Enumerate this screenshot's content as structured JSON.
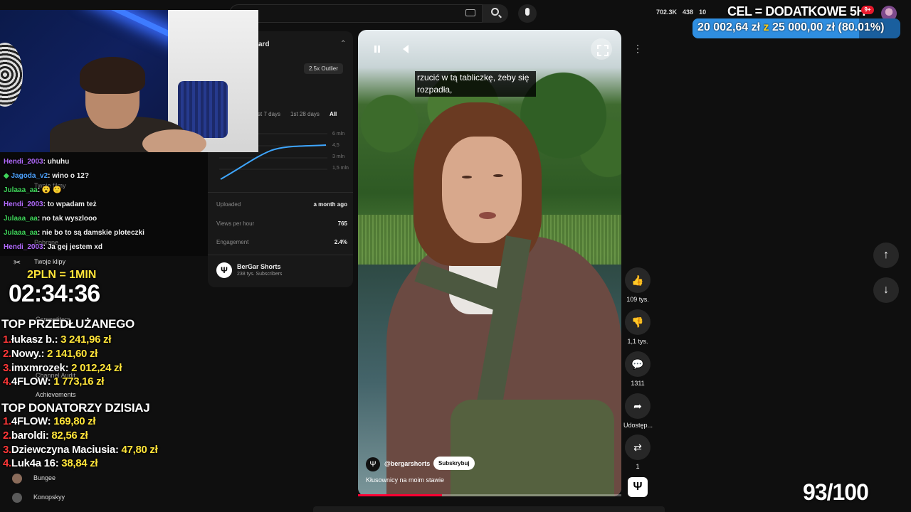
{
  "topbar": {
    "stats": [
      "702.3K",
      "438",
      "10"
    ],
    "notif_count": "9+"
  },
  "goal": {
    "title": "CEL = DODATKOWE 5H",
    "current": "20 002,64 zł",
    "joiner": "z",
    "target": "25 000,00 zł",
    "percent_label": "(80.01%)",
    "progress_fraction": 0.8001,
    "bar_color": "#1a5f9e",
    "fill_color": "#2f8ee0"
  },
  "panel": {
    "title": "ard",
    "outlier": "2.5x Outlier",
    "ranges": [
      "st 7 days",
      "1st 28 days",
      "All"
    ],
    "yticks": [
      "6 mln",
      "4,5",
      "3 mln",
      "1,5 mln"
    ],
    "rows": [
      {
        "label": "Uploaded",
        "value": "a month ago"
      },
      {
        "label": "Views per hour",
        "value": "765"
      },
      {
        "label": "Engagement",
        "value": "2.4%"
      }
    ],
    "channel_name": "BerGar Shorts",
    "channel_subs": "238 tys. Subscribers"
  },
  "sidebar_ghost": [
    {
      "label": "Twoje filmy"
    },
    {
      "label": "Pobrane"
    },
    {
      "label": "Twoje klipy"
    },
    {
      "label": "Competitors"
    },
    {
      "label": "Channel Audit"
    },
    {
      "label": "Achievements"
    }
  ],
  "chat": [
    {
      "user": "Hendi_2003",
      "msg": ": uhuhu",
      "color": "#b36bff"
    },
    {
      "user": "Jagoda_v2",
      "msg": ": wino o 12?",
      "color": "#4da3ff"
    },
    {
      "user": "Julaaa_aa",
      "msg": ": 😮 🙂",
      "color": "#3fd45a"
    },
    {
      "user": "Hendi_2003",
      "msg": ": to wpadam też",
      "color": "#b36bff"
    },
    {
      "user": "Julaaa_aa",
      "msg": ": no tak wyszlooo",
      "color": "#3fd45a"
    },
    {
      "user": "Julaaa_aa",
      "msg": ": nie bo to są damskie ploteczki",
      "color": "#3fd45a"
    },
    {
      "user": "Hendi_2003",
      "msg": ": Ja gej jestem xd",
      "color": "#b36bff"
    }
  ],
  "timer": {
    "rate": "2PLN = 1MIN",
    "value": "02:34:36"
  },
  "top_extend": {
    "heading": "TOP PRZEDŁUŻANEGO",
    "entries": [
      {
        "n": "1.",
        "name": "łukasz b.: ",
        "amount": "3 241,96 zł"
      },
      {
        "n": "2.",
        "name": "Nowy.: ",
        "amount": "2 141,60 zł"
      },
      {
        "n": "3.",
        "name": "imxmrozek: ",
        "amount": "2 012,24 zł"
      },
      {
        "n": "4.",
        "name": "4FLOW: ",
        "amount": "1 773,16 zł"
      }
    ]
  },
  "top_today": {
    "heading": "TOP DONATORZY DZISIAJ",
    "entries": [
      {
        "n": "1.",
        "name": "4FLOW: ",
        "amount": "169,80 zł"
      },
      {
        "n": "2.",
        "name": "baroldi: ",
        "amount": "82,56 zł"
      },
      {
        "n": "3.",
        "name": "Dziewczyna Maciusia: ",
        "amount": "47,80 zł"
      },
      {
        "n": "4.",
        "name": "Luk4a 16: ",
        "amount": "38,84 zł"
      }
    ]
  },
  "sidebar_bottom": [
    "Bungee",
    "Konopskyy"
  ],
  "video": {
    "caption": "rzucić w tą tabliczkę, żeby się rozpadła,",
    "channel_handle": "@bergarshorts",
    "subscribe_label": "Subskrybuj",
    "title": "Kłusownicy na moim stawie",
    "progress_fraction": 0.32
  },
  "actions": [
    {
      "icon": "👍",
      "label": "109 tys."
    },
    {
      "icon": "👎",
      "label": "1,1 tys."
    },
    {
      "icon": "💬",
      "label": "1311"
    },
    {
      "icon": "➦",
      "label": "Udostęp..."
    },
    {
      "icon": "⇄",
      "label": "1"
    }
  ],
  "counter": "93/100"
}
